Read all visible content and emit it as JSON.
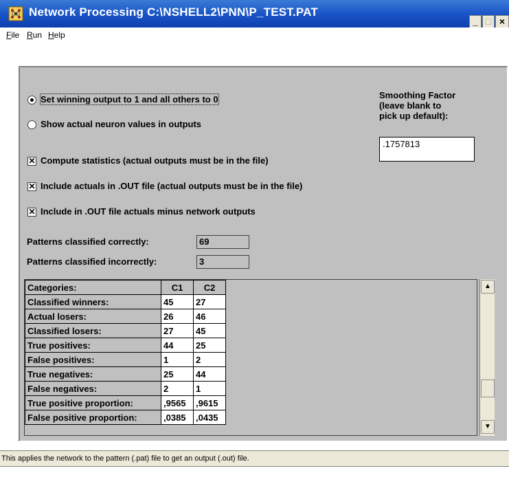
{
  "window": {
    "title": "Network Processing C:\\NSHELL2\\PNN\\P_TEST.PAT",
    "minimize_label": "_",
    "maximize_label": "□",
    "close_label": "×"
  },
  "menu": {
    "file": "File",
    "run": "Run",
    "help": "Help"
  },
  "options": {
    "radio_winning": "Set winning output to 1 and all others to 0",
    "radio_winning_selected": true,
    "radio_actual": "Show actual neuron values in outputs",
    "check_stats": "Compute statistics (actual outputs must be in the file)",
    "check_include_actuals": "Include actuals in .OUT file (actual outputs must be in the file)",
    "check_minus": "Include in .OUT file actuals minus network outputs",
    "check_mark": "✕"
  },
  "smoothing": {
    "label_line1": "Smoothing Factor",
    "label_line2": "(leave blank to",
    "label_line3": "pick up default):",
    "value": ".1757813"
  },
  "counts": {
    "correct_label": "Patterns classified correctly:",
    "correct_value": "69",
    "incorrect_label": "Patterns classified incorrectly:",
    "incorrect_value": "3"
  },
  "table": {
    "header": [
      "Categories:",
      "C1",
      "C2"
    ],
    "rows": [
      [
        "Classified winners:",
        "45",
        "27"
      ],
      [
        "Actual losers:",
        "26",
        "46"
      ],
      [
        "Classified losers:",
        "27",
        "45"
      ],
      [
        "True positives:",
        "44",
        "25"
      ],
      [
        "False positives:",
        "1",
        "2"
      ],
      [
        "True negatives:",
        "25",
        "44"
      ],
      [
        "False negatives:",
        "2",
        "1"
      ],
      [
        "True positive proportion:",
        ",9565",
        ",9615"
      ],
      [
        "False positive proportion:",
        ",0385",
        ",0435"
      ]
    ]
  },
  "scroll": {
    "up": "▲",
    "down": "▼"
  },
  "status": "This applies the network to the pattern (.pat) file to get an output (.out) file."
}
